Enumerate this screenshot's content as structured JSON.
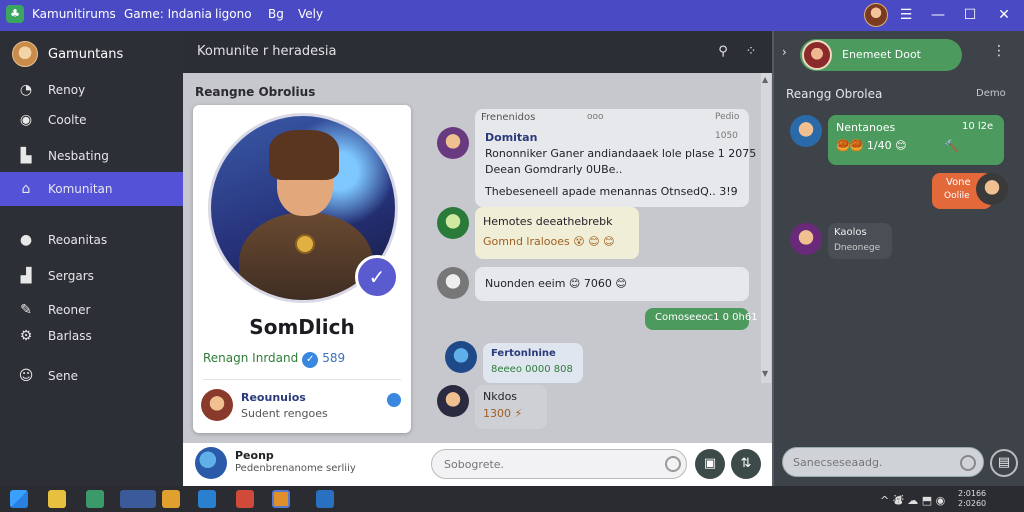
{
  "titlebar": {
    "menus": [
      "Kamunitirums",
      "Game: Indania",
      "ligono",
      "Bg",
      "Vely"
    ],
    "icons": [
      "app-icon",
      "menu-icon",
      "minimize-icon",
      "maximize-icon",
      "close-icon"
    ]
  },
  "sidebar": {
    "header": "Gamuntans",
    "items": [
      {
        "label": "Renoy",
        "icon": "clock-icon"
      },
      {
        "label": "Coolte",
        "icon": "dot-icon"
      },
      {
        "label": "Nesbating",
        "icon": "bookmark-icon"
      },
      {
        "label": "Komunitan",
        "icon": "home-icon",
        "active": true
      },
      {
        "label": "Reoanitas",
        "icon": "circle-icon"
      },
      {
        "label": "Sergars",
        "icon": "chart-icon"
      },
      {
        "label": "Reoner",
        "icon": "pencil-icon"
      },
      {
        "label": "Barlass",
        "icon": "gear-icon"
      },
      {
        "label": "Sene",
        "icon": "smile-icon"
      }
    ]
  },
  "center": {
    "header_title": "Komunite r heradesia",
    "section_title": "Reangne Obrolius",
    "profile": {
      "name": "SomDlich",
      "subtitle": "Renagn Inrdand",
      "count": "589",
      "friend_title": "Reounuios",
      "friend_sub": "Sudent rengoes"
    },
    "messages_header": {
      "left": "Frenenidos",
      "mid": "ooo",
      "right": "Pedio"
    },
    "messages": [
      {
        "title": "Domitan",
        "lines": [
          "Rononniker Ganer andiandaaek lole plase 1 2075",
          "Deean Gomdrarly 0UBe..",
          "Thebeseneell apade menannas OtnsedQ.. 3!9"
        ],
        "side_time": "1050"
      },
      {
        "lines": [
          "Hemotes deeathebrebk",
          "Gomnd lralooes 😵 😊 😊"
        ]
      },
      {
        "lines": [
          "Nuonden eeim 😊 7060 😊"
        ]
      },
      {
        "lines": [
          "Comoseeoc1 0 0h61"
        ],
        "mine": true
      },
      {
        "lines": [
          "Fertonlnine",
          "8eeeo 0000 808"
        ]
      },
      {
        "lines": [
          "Nkdos",
          "1300 ⚡"
        ]
      }
    ],
    "bottom": {
      "title": "Peonp",
      "subtitle": "Pedenbrenanome serliiy",
      "input_placeholder": "Sobogrete."
    }
  },
  "right": {
    "header_name": "Enemeet Doot",
    "section": "Reangg Obrolea",
    "section_right": "Demo",
    "messages": [
      {
        "name": "Nentanoes",
        "time": "10 l2e",
        "line": "🥮🥮 1/40 😊",
        "extra": "🔨"
      },
      {
        "name": "Vone",
        "line": "Oolile",
        "mine": true
      },
      {
        "name": "Kaolos",
        "line": "Dneonege"
      }
    ],
    "input_placeholder": "Sanecseseaadg."
  },
  "taskbar": {
    "clock_line1": "2:0166",
    "clock_line2": "2:0260",
    "tray": "^ ⛇ ☁ ⬒ ◉"
  },
  "colors": {
    "titlebar": "#4a4ac4",
    "active_nav": "#5452d6",
    "green_bubble": "#4c9a5e",
    "orange_bubble": "#e3683a"
  }
}
